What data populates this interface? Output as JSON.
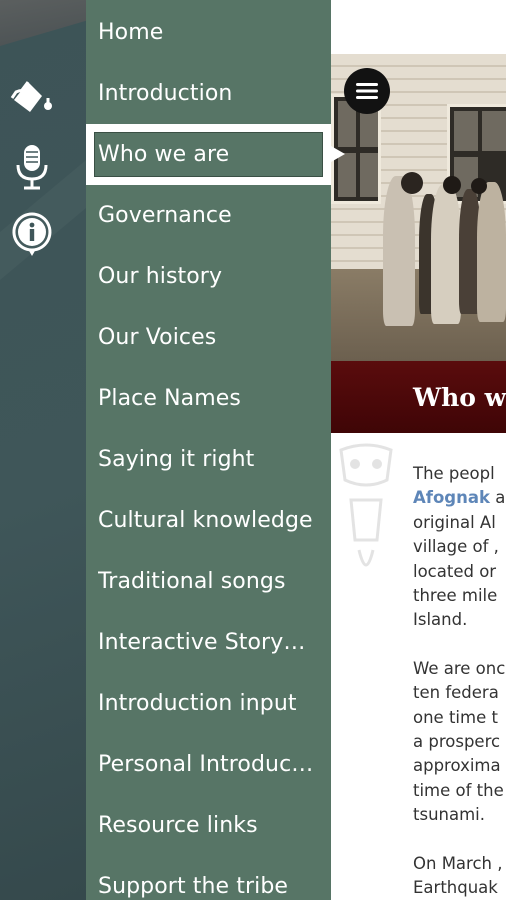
{
  "rail": {
    "icons": [
      "paint-bucket-icon",
      "microphone-icon",
      "info-icon"
    ]
  },
  "menu": {
    "items": [
      {
        "label": "Home"
      },
      {
        "label": "Introduction"
      },
      {
        "label": "Who we are",
        "selected": true
      },
      {
        "label": "Governance"
      },
      {
        "label": "Our history"
      },
      {
        "label": "Our Voices"
      },
      {
        "label": "Place Names"
      },
      {
        "label": "Saying it right"
      },
      {
        "label": "Cultural knowledge"
      },
      {
        "label": "Traditional songs"
      },
      {
        "label": "Interactive Storyb…"
      },
      {
        "label": "Introduction input"
      },
      {
        "label": "Personal Introduc…"
      },
      {
        "label": "Resource links"
      },
      {
        "label": "Support the tribe"
      }
    ]
  },
  "content": {
    "title": "Who w",
    "para1": [
      "The peopl",
      "Afognak",
      " a",
      "original Al",
      "village of ,",
      "located or",
      "three mile",
      "Island."
    ],
    "para2": [
      "We are onc",
      "ten federa",
      "one time t",
      "a prosperc",
      "approxima",
      "time of the",
      "tsunami."
    ],
    "para3": [
      "On March ,",
      "Earthquak"
    ]
  },
  "colors": {
    "rail": "#3f5659",
    "drawer": "#577566",
    "title_bar": "#4d0809",
    "link": "#5e86b8"
  }
}
